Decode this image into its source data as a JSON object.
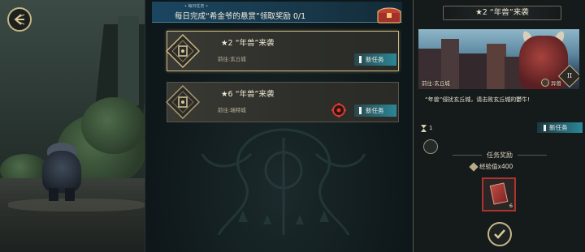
{
  "daily_task": {
    "tag": "• 每日任务 •",
    "text": "每日完成“希金爷的悬赏”领取奖励 0/1"
  },
  "quests": [
    {
      "title": "★2 “年兽”来袭",
      "goto": "前往:玄丘城",
      "badge": "新任务",
      "selected": true
    },
    {
      "title": "★6 “年兽”来袭",
      "goto": "前往:瑞特城",
      "badge": "新任务",
      "selected": false
    }
  ],
  "detail": {
    "title": "★2 “年兽”来袭",
    "goto": "前往:玄丘城",
    "kind": "异兽",
    "tier": "II",
    "description": "“年兽”侵扰玄丘城，请击败玄丘城的鬱牛!",
    "progress": "1",
    "badge": "新任务",
    "rewards_title": "任务奖励",
    "exp": "经验值x400",
    "item_qty": "6"
  },
  "icons": [
    "back-icon",
    "chest-icon",
    "quest-emblem-icon",
    "bomb-icon",
    "hourglass-icon",
    "gear-icon",
    "gem-icon",
    "check-icon"
  ],
  "colors": {
    "accent_gold": "#cbb882",
    "badge_teal": "#2b8797",
    "item_red": "#b0322e"
  }
}
